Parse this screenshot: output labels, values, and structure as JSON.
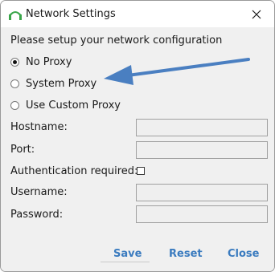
{
  "window": {
    "title": "Network Settings"
  },
  "heading": "Please setup your network configuration",
  "proxy_options": [
    {
      "label": "No Proxy",
      "checked": true
    },
    {
      "label": "System Proxy",
      "checked": false
    },
    {
      "label": "Use Custom Proxy",
      "checked": false
    }
  ],
  "fields": {
    "hostname_label": "Hostname:",
    "hostname_value": "",
    "port_label": "Port:",
    "port_value": "",
    "auth_label": "Authentication required:",
    "auth_checked": false,
    "username_label": "Username:",
    "username_value": "",
    "password_label": "Password:",
    "password_value": ""
  },
  "footer": {
    "save_label": "Save",
    "reset_label": "Reset",
    "close_label": "Close"
  },
  "colors": {
    "accent": "#3a7bbf",
    "logo": "#3aa64a",
    "annotation_arrow": "#4a7fc1"
  },
  "icons": {
    "app_logo": "app-logo-icon",
    "close": "close-icon",
    "annotation": "annotation-arrow-icon"
  }
}
